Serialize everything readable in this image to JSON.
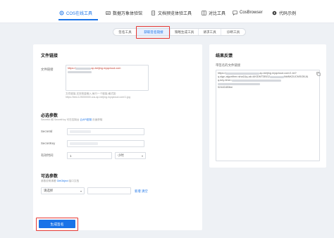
{
  "topnav": {
    "tabs": [
      {
        "label": "COS在线工具",
        "icon": "tools-icon",
        "active": true
      },
      {
        "label": "数据万象体验馆",
        "icon": "image-icon",
        "active": false
      },
      {
        "label": "文档预览体验工具",
        "icon": "document-icon",
        "active": false
      },
      {
        "label": "对比工具",
        "icon": "compare-icon",
        "active": false
      },
      {
        "label": "CosBrowser",
        "icon": "browser-icon",
        "active": false
      },
      {
        "label": "代码示例",
        "icon": "code-icon",
        "active": false
      }
    ],
    "accent": "#1a73e8"
  },
  "subtabs": [
    {
      "label": "签名工具",
      "active": false
    },
    {
      "label": "获取签名链接",
      "active": true
    },
    {
      "label": "策略生成工具",
      "active": false
    },
    {
      "label": "请求工具",
      "active": false
    },
    {
      "label": "诊断工具",
      "active": false
    }
  ],
  "file_link": {
    "section_title": "文件链接",
    "label": "文件链接",
    "value_prefix": "https://",
    "value_domain": "ap-beijing.myqcloud.com",
    "hint_line1": "文件链接,支持批量输入,每行一个链接,格式如:",
    "hint_line2": "https://test-125000000.cos.ap-beijing.myqcloud.com/1.jpg"
  },
  "required": {
    "section_title": "必选参数",
    "desc": "SecretId 和 SecretKey 可在控制台",
    "desc_link": "云API密钥",
    "desc_tail": "页面获取",
    "secret_id_label": "SecretId",
    "secret_key_label": "SecretKey",
    "expire_label": "有效时间",
    "expire_value": "1",
    "expire_unit": "小时"
  },
  "optional": {
    "section_title": "可选参数",
    "desc": "参数说明请看",
    "desc_link": "GetObject",
    "desc_tail": "接口文档",
    "select_placeholder": "请选择",
    "add_label": "新增",
    "clear_label": "清空"
  },
  "actions": {
    "generate_label": "生成签名"
  },
  "result": {
    "section_title": "结果反馈",
    "label": "带签名的文件链接",
    "value_prefix": "https://",
    "value_mid": "ap-beijing.myqcloud.com/1.txt?",
    "value_line2_a": "q-sign-algorithm=sha1&q-ak=AKIDMT3BG2",
    "value_line2_b": "NtdNK2UCMSOBJ&",
    "value_line3": "q-key-time=",
    "value_line4": "5244D4Bfee"
  }
}
